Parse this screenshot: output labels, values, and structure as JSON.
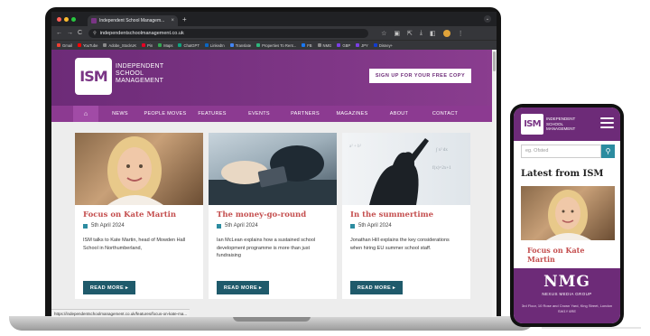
{
  "browser": {
    "tab_title": "Independent School Managem...",
    "tab_close": "×",
    "new_tab": "+",
    "url": "independentschoolmanagement.co.uk",
    "nav_back": "←",
    "nav_forward": "→",
    "nav_reload": "C",
    "bookmarks": [
      {
        "label": "Gmail",
        "color": "#ea4335"
      },
      {
        "label": "YouTube",
        "color": "#ff0000"
      },
      {
        "label": "Adobe_StockUK",
        "color": "#8a8a8a"
      },
      {
        "label": "Pin",
        "color": "#e60023"
      },
      {
        "label": "Maps",
        "color": "#34a853"
      },
      {
        "label": "ChatGPT",
        "color": "#10a37f"
      },
      {
        "label": "LinkedIn",
        "color": "#0a66c2"
      },
      {
        "label": "Translate",
        "color": "#4285f4"
      },
      {
        "label": "Properties To Rent...",
        "color": "#2fb67c"
      },
      {
        "label": "FB",
        "color": "#1877f2"
      },
      {
        "label": "NMG",
        "color": "#8a8a8a"
      },
      {
        "label": "GBP",
        "color": "#7b3fe4"
      },
      {
        "label": "JPY",
        "color": "#7b3fe4"
      },
      {
        "label": "Disney+",
        "color": "#113ccf"
      }
    ],
    "status_url": "https://independentschoolmanagement.co.uk/features/focus-on-kate-ma..."
  },
  "site": {
    "logo_text": "ISM",
    "logo_words": [
      "INDEPENDENT",
      "SCHOOL",
      "MANAGEMENT"
    ],
    "signup_label": "SIGN UP FOR YOUR FREE COPY",
    "nav_items": [
      "NEWS",
      "PEOPLE MOVES",
      "FEATURES",
      "EVENTS",
      "PARTNERS",
      "MAGAZINES",
      "ABOUT",
      "CONTACT"
    ],
    "cards": [
      {
        "title": "Focus on Kate Martin",
        "date": "5th April 2024",
        "text": "ISM talks to Kate Martin, head of Mowden Hall School in Northumberland,",
        "button": "READ MORE ▸"
      },
      {
        "title": "The money-go-round",
        "date": "5th April 2024",
        "text": "Ian McLean explains how a sustained school development programme is more than just fundraising",
        "button": "READ MORE ▸"
      },
      {
        "title": "In the summertime",
        "date": "5th April 2024",
        "text": "Jonathan Hill explains the key considerations when hiring EU summer school staff.",
        "button": "READ MORE ▸"
      }
    ]
  },
  "phone": {
    "logo_text": "ISM",
    "logo_words": [
      "INDEPENDENT",
      "SCHOOL",
      "MANAGEMENT"
    ],
    "search_placeholder": "eg. Ofsted",
    "latest_heading": "Latest from ISM",
    "card_title": "Focus on Kate Martin",
    "footer_logo": "NMG",
    "footer_sub": "NEXUS MEDIA GROUP",
    "footer_address": "3rd Floor, 10 Rose and Crown Yard, King Street, London SW1Y 6RE"
  },
  "colors": {
    "brand_purple": "#6d2b78",
    "nav_purple": "#8c3a91",
    "title_red": "#c44e4e",
    "button_teal": "#1f5a6b"
  }
}
